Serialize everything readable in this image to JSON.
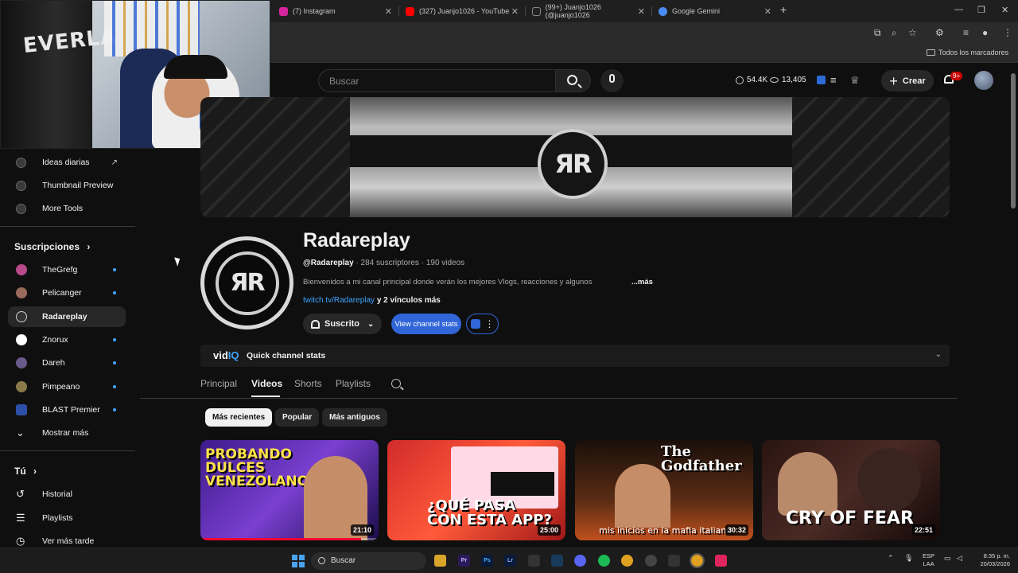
{
  "browser": {
    "tabs": [
      {
        "title": "(7) Instagram",
        "favicon_color": "#d6249f"
      },
      {
        "title": "(327) Juanjo1026 - YouTube",
        "favicon_color": "#ff0000"
      },
      {
        "title": "(99+) Juanjo1026 (@juanjo1026",
        "favicon_color": "#222222"
      },
      {
        "title": "Google Gemini",
        "favicon_color": "#4a8cf7"
      }
    ],
    "new_tab": "+",
    "bookmarks_all": "Todos los marcadores"
  },
  "webcam": {
    "bag_text": "EVERLA"
  },
  "header": {
    "search_placeholder": "Buscar",
    "stat_watch": "54.4K",
    "stat_views": "13,405",
    "create_label": "Crear",
    "notif_count": "9+"
  },
  "sidebar": {
    "tools": [
      {
        "label": "Ideas diarias"
      },
      {
        "label": "Thumbnail Preview"
      },
      {
        "label": "More Tools"
      }
    ],
    "subs_title": "Suscripciones",
    "subscriptions": [
      {
        "label": "TheGrefg",
        "color": "#b84a8a",
        "dot": true
      },
      {
        "label": "Pelicanger",
        "color": "#9a6b5a",
        "dot": true
      },
      {
        "label": "Radareplay",
        "color": "#555555",
        "dot": false,
        "active": true
      },
      {
        "label": "Znorux",
        "color": "#ffffff",
        "dot": true
      },
      {
        "label": "Dareh",
        "color": "#6a5a8a",
        "dot": true
      },
      {
        "label": "Pimpeano",
        "color": "#8a7a4a",
        "dot": true
      },
      {
        "label": "BLAST Premier",
        "color": "#2d4fa8",
        "dot": true
      }
    ],
    "show_more": "Mostrar más",
    "you_title": "Tú",
    "you_items": [
      {
        "label": "Historial"
      },
      {
        "label": "Playlists"
      },
      {
        "label": "Ver más tarde"
      }
    ]
  },
  "banner": {
    "logo_text": "ЯR"
  },
  "channel": {
    "name": "Radareplay",
    "handle": "@Radareplay",
    "meta": " · 284 suscriptores · 190 videos",
    "description": "Bienvenidos a mi canal principal donde verán los mejores  Vlogs, reacciones y algunos",
    "more": "...más",
    "link": "twitch.tv/Radareplay",
    "link_more": " y 2 vínculos más",
    "subscribe_label": "Suscrito",
    "stats_btn": "View channel stats",
    "avatar_text": "ЯR"
  },
  "quick_stats": {
    "logo_a": "vid",
    "logo_b": "IQ",
    "label": "Quick channel stats"
  },
  "tabs": [
    "Principal",
    "Videos",
    "Shorts",
    "Playlists"
  ],
  "active_tab": "Videos",
  "chips": [
    "Más recientes",
    "Popular",
    "Más antiguos"
  ],
  "videos": [
    {
      "thumb_text": "PROBANDO DULCES VENEZOLANOS",
      "duration": "21:10",
      "bg": "#5a2a9a",
      "progress": 0.9
    },
    {
      "thumb_text": "¿QUÉ PASA CON ESTA APP?",
      "duration": "25:00",
      "bg": "#c0302a",
      "progress": 0
    },
    {
      "thumb_text": "The Godfather",
      "caption": "mis inicios en la mafia italiana",
      "duration": "30:32",
      "bg": "#3a2418",
      "progress": 0
    },
    {
      "thumb_text": "CRY OF FEAR",
      "duration": "22:51",
      "bg": "#2a1a18",
      "progress": 0
    }
  ],
  "taskbar": {
    "search": "Buscar",
    "lang_1": "ESP",
    "lang_2": "LAA",
    "time": "8:35 p. m.",
    "date": "20/03/2026"
  }
}
